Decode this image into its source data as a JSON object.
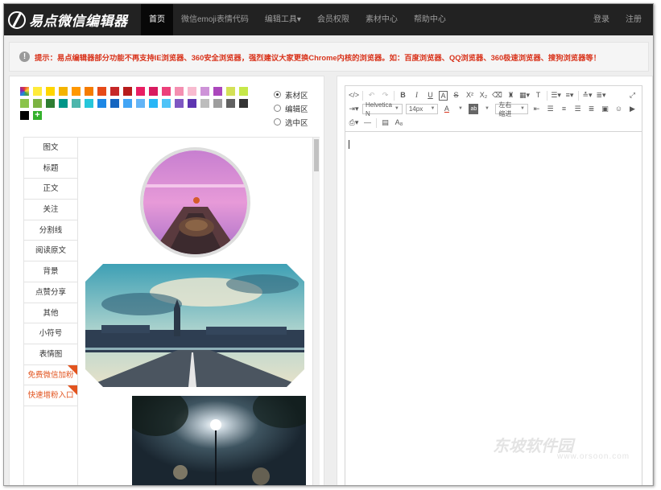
{
  "logo": {
    "text": "易点微信编辑器",
    "icon": "logo-icon"
  },
  "nav": {
    "items": [
      {
        "label": "首页",
        "active": true
      },
      {
        "label": "微信emoji表情代码"
      },
      {
        "label": "编辑工具▾"
      },
      {
        "label": "会员权限"
      },
      {
        "label": "素材中心"
      },
      {
        "label": "帮助中心"
      }
    ],
    "login": "登录",
    "register": "注册"
  },
  "alert": {
    "icon": "warning-icon",
    "text": "提示：易点编辑器部分功能不再支持IE浏览器、360安全浏览器，强烈建议大家更换Chrome内核的浏览器。如：百度浏览器、QQ浏览器、360极速浏览器、搜狗浏览器等！"
  },
  "palette": {
    "colors": [
      "#ffeb3b",
      "#ffd600",
      "#f4b400",
      "#ff9800",
      "#f57c00",
      "#e64a19",
      "#c62828",
      "#b71c1c",
      "#e91e63",
      "#d81b60",
      "#ec407a",
      "#f48fb1",
      "#f8bbd0",
      "#ce93d8",
      "#ab47bc",
      "#d4e157",
      "#c6e84a",
      "#8bc34a",
      "#7cb342",
      "#2e7d32",
      "#009688",
      "#4db6ac",
      "#26c6da",
      "#1e88e5",
      "#1565c0",
      "#42a5f5",
      "#64b5f6",
      "#29b6f6",
      "#4fc3f7",
      "#7e57c2",
      "#5e35b1",
      "#bdbdbd",
      "#9e9e9e",
      "#616161",
      "#333333",
      "#000000"
    ],
    "add_label": "+"
  },
  "radios": [
    {
      "label": "素材区",
      "checked": true
    },
    {
      "label": "编辑区",
      "checked": false
    },
    {
      "label": "选中区",
      "checked": false
    }
  ],
  "tabs": [
    {
      "label": "图文"
    },
    {
      "label": "标题"
    },
    {
      "label": "正文"
    },
    {
      "label": "关注"
    },
    {
      "label": "分割线"
    },
    {
      "label": "阅读原文"
    },
    {
      "label": "背景"
    },
    {
      "label": "点赞分享"
    },
    {
      "label": "其他"
    },
    {
      "label": "小符号"
    },
    {
      "label": "表情图"
    },
    {
      "label": "免费微信加粉",
      "promo": true
    },
    {
      "label": "快速增粉入口",
      "promo": true
    }
  ],
  "toolbar": {
    "font_family": "Helvetica N",
    "font_size": "14px",
    "indent": "左右缩进",
    "text_color_label": "A",
    "ab_label": "ab",
    "superscript": "X²",
    "subscript": "X₂",
    "bold": "B",
    "italic": "I",
    "underline": "U",
    "strikethrough": "S",
    "boxed_a": "A",
    "size_label": "A₈"
  },
  "watermark": {
    "text": "东坡软件园",
    "url": "www.orsoon.com"
  }
}
